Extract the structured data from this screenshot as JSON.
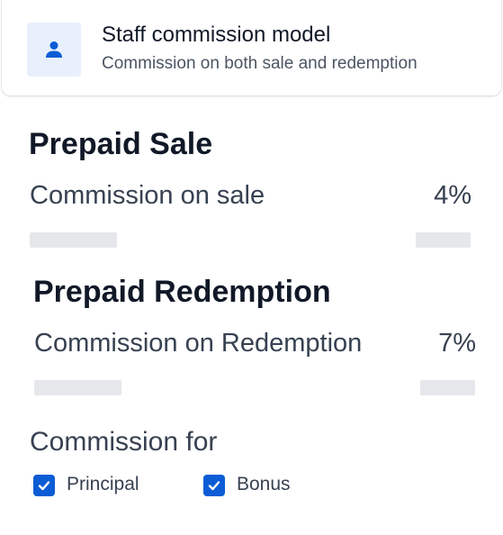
{
  "model_card": {
    "icon": "person-icon",
    "title": "Staff commission model",
    "subtitle": "Commission on both sale and redemption",
    "accent_bg": "#e8f0fe",
    "accent": "#0b5cd5"
  },
  "prepaid_sale": {
    "heading": "Prepaid Sale",
    "label": "Commission on sale",
    "value": "4%"
  },
  "prepaid_redemption": {
    "heading": "Prepaid Redemption",
    "label": "Commission on Redemption",
    "value": "7%"
  },
  "commission_for": {
    "heading": "Commission for",
    "options": [
      {
        "label": "Principal",
        "checked": true
      },
      {
        "label": "Bonus",
        "checked": true
      }
    ]
  }
}
